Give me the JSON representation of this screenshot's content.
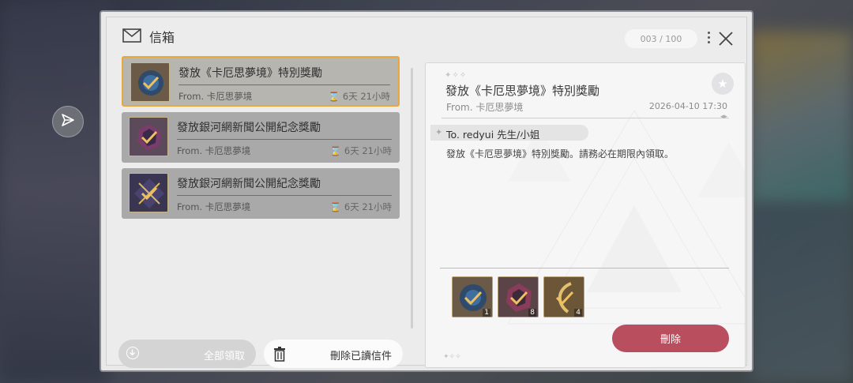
{
  "window": {
    "title": "信箱",
    "counter": "003 / 100"
  },
  "mails": [
    {
      "title": "發放《卡厄思夢境》特別獎勵",
      "from": "From. 卡厄思夢境",
      "time": "6天 21小時",
      "selected": true
    },
    {
      "title": "發放銀河網新聞公開紀念獎勵",
      "from": "From. 卡厄思夢境",
      "time": "6天 21小時",
      "selected": false
    },
    {
      "title": "發放銀河網新聞公開紀念獎勵",
      "from": "From. 卡厄思夢境",
      "time": "6天 21小時",
      "selected": false
    }
  ],
  "buttons": {
    "claim_all": "全部領取",
    "delete_read": "刪除已讀信件",
    "delete": "刪除"
  },
  "detail": {
    "title": "發放《卡厄思夢境》特別獎勵",
    "from": "From. 卡厄思夢境",
    "date": "2026-04-10 17:30",
    "to": "To. redyui 先生/小姐",
    "body": "發放《卡厄思夢境》特別獎勵。請務必在期限內領取。",
    "attachments": [
      {
        "qty": "1"
      },
      {
        "qty": "8"
      },
      {
        "qty": "4"
      }
    ]
  },
  "icons": {
    "title": "envelope-icon",
    "close": "close-icon",
    "more": "more-vertical-icon",
    "favorite": "star-icon",
    "side": "send-icon"
  },
  "colors": {
    "selected_border": "#e9a93a",
    "delete_button": "#b84e5e"
  }
}
